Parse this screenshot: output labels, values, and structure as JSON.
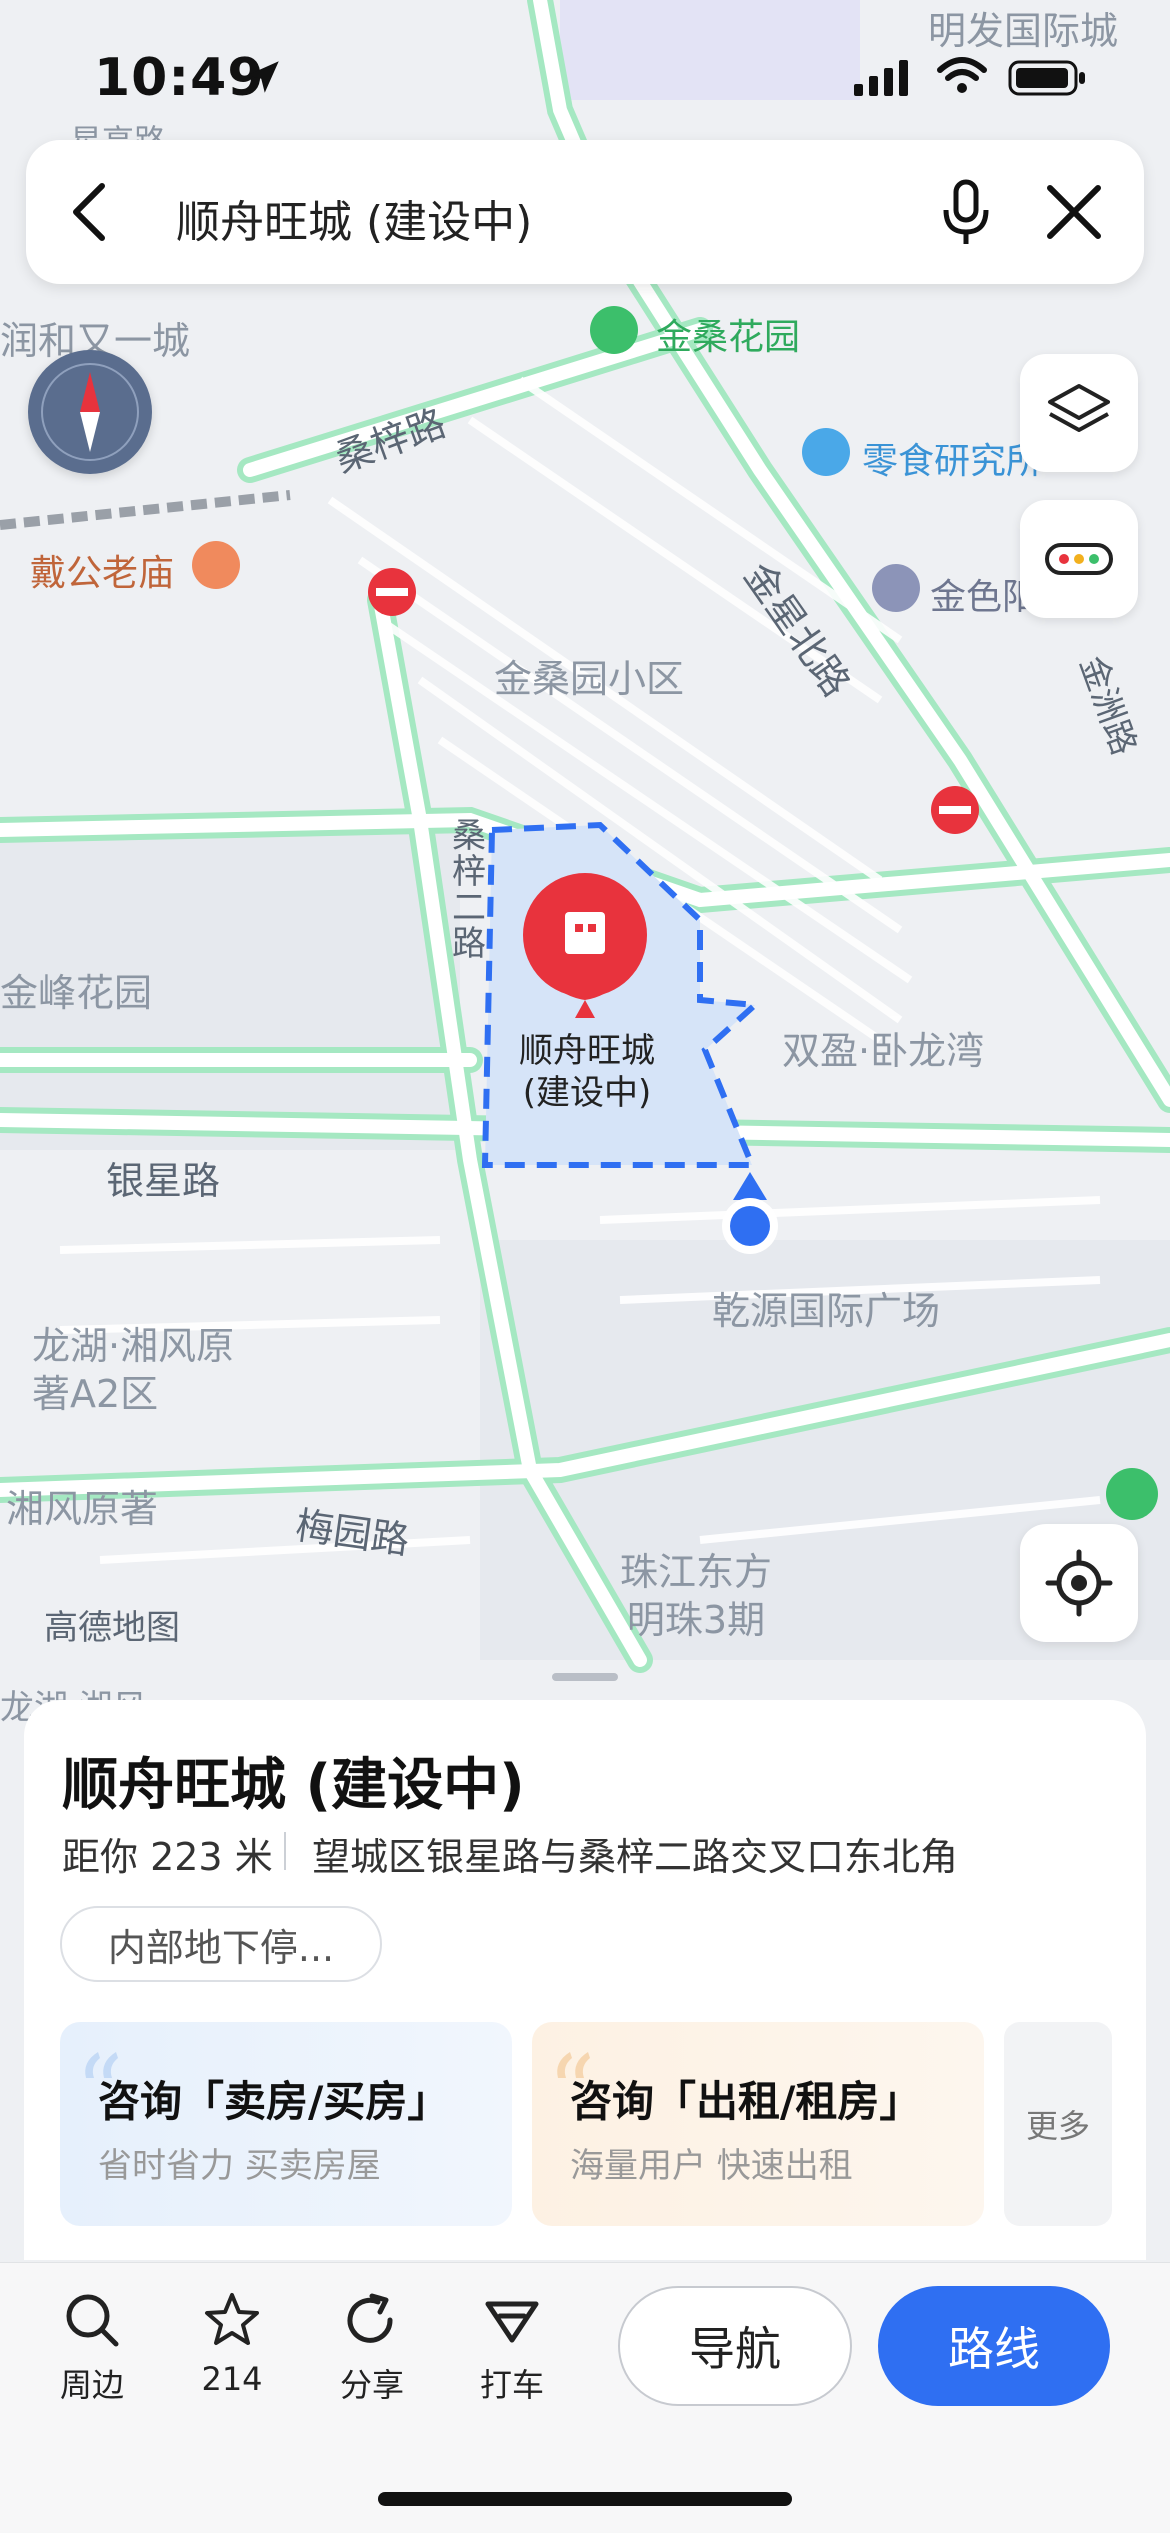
{
  "status_bar": {
    "time": "10:49"
  },
  "search": {
    "query": "顺舟旺城 (建设中)"
  },
  "map": {
    "labels": {
      "mingfa": "明发国际城",
      "heyou": "润和又一城",
      "jinsang_garden": "金桑花园",
      "sangzi_road": "桑梓路",
      "lingshi": "零食研究所",
      "daigong": "戴公老庙",
      "jinse": "金色阳光",
      "jinsang_n_road": "金星北路",
      "jinsang_community": "金桑园小区",
      "jinzhu_road": "金洲路",
      "sangzi2_road": "桑梓二路",
      "jinfeng": "金峰花园",
      "place_marker": "顺舟旺城(建设中)",
      "shuangying": "双盈·卧龙湾",
      "yinxing_road": "银星路",
      "qianyuan": "乾源国际广场",
      "longhu_a2": "龙湖·湘风原著A2区",
      "xiangfeng": "湘风原著",
      "meiyuan_road": "梅园路",
      "zhujiang": "珠江东方明珠3期",
      "watermark": "高德地图",
      "longhu_bottom": "龙湖·湘风",
      "top_left_road": "星高路"
    }
  },
  "sheet": {
    "title": "顺舟旺城 (建设中)",
    "distance": "距你 223 米",
    "address": "望城区银星路与桑梓二路交叉口东北角",
    "tag": "内部地下停...",
    "cards": [
      {
        "title": "咨询「卖房/买房」",
        "subtitle": "省时省力 买卖房屋"
      },
      {
        "title": "咨询「出租/租房」",
        "subtitle": "海量用户 快速出租"
      }
    ],
    "more": "更多"
  },
  "toolbar": {
    "nearby": "周边",
    "favorites": "214",
    "share": "分享",
    "taxi": "打车",
    "navigate": "导航",
    "route": "路线"
  },
  "colors": {
    "accent": "#2f6ff2",
    "marker": "#e8333d",
    "area_fill": "#d6e4f8",
    "area_border": "#2f6ff2",
    "road_green": "#8fe3b4"
  }
}
